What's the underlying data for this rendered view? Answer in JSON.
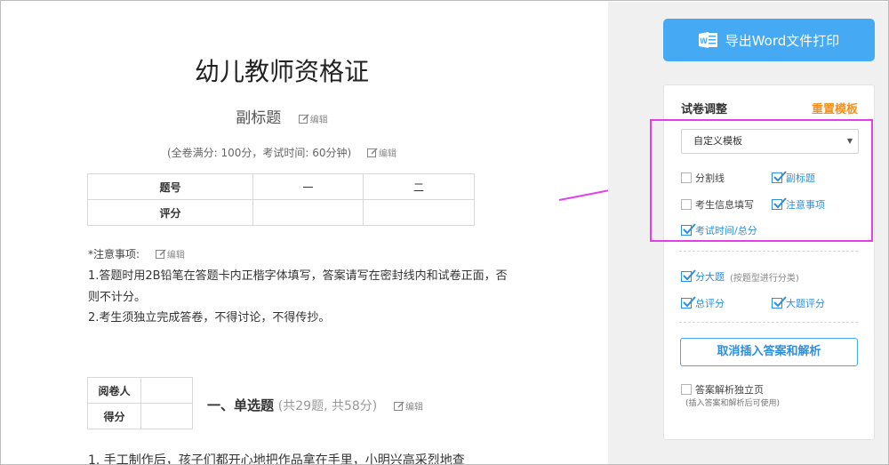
{
  "paper": {
    "title": "幼儿教师资格证",
    "subtitle": "副标题",
    "edit_label": "编辑",
    "exam_info": "(全卷满分: 100分，考试时间: 60分钟)",
    "score_table": {
      "header_label": "题号",
      "score_label": "评分",
      "columns": [
        "一",
        "二"
      ]
    },
    "notice_title": "*注意事项:",
    "notice_lines": [
      "1.答题时用2B铅笔在答题卡内正楷字体填写，答案请写在密封线内和试卷正面，否",
      "则不计分。",
      "2.考生须独立完成答卷，不得讨论，不得传抄。"
    ],
    "grader_table": {
      "reviewer_label": "阅卷人",
      "score_label": "得分"
    },
    "section_title": "一、单选题",
    "section_meta": "(共29题, 共58分)",
    "question_1": "1. 手工制作后，孩子们都开心地把作品拿在手里，小明兴高采烈地查"
  },
  "sidebar": {
    "export_button": "导出Word文件打印",
    "panel_title": "试卷调整",
    "reset_link": "重置模板",
    "template_select": "自定义模板",
    "options": {
      "divider": {
        "label": "分割线",
        "checked": false
      },
      "subtitle": {
        "label": "副标题",
        "checked": true
      },
      "student_info": {
        "label": "考生信息填写",
        "checked": false
      },
      "notice": {
        "label": "注意事项",
        "checked": true
      },
      "exam_time": {
        "label": "考试时间/总分",
        "checked": true
      },
      "big_question": {
        "label": "分大题",
        "hint": "(按题型进行分类)",
        "checked": true
      },
      "total_score": {
        "label": "总评分",
        "checked": true
      },
      "section_score": {
        "label": "大题评分",
        "checked": true
      },
      "answer_standalone": {
        "label": "答案解析独立页",
        "checked": false
      }
    },
    "cancel_button": "取消插入答案和解析",
    "answer_note": "(插入答案和解析后可使用)"
  },
  "colors": {
    "primary_blue": "#45a9f3",
    "checked_blue": "#2a8fe5",
    "reset_orange": "#f5911e",
    "highlight_magenta": "#e53ee8"
  }
}
